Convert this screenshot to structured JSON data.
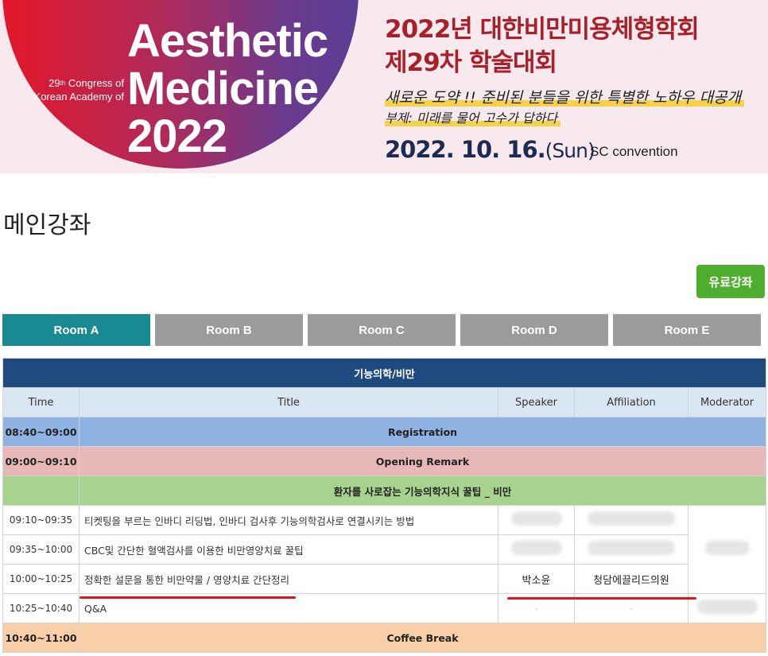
{
  "banner": {
    "congress_sup": "th",
    "congress_prefix": "29",
    "congress_line1": "Congress of",
    "congress_line2": "Korean Academy of",
    "title_line1": "Aesthetic",
    "title_line2": "Medicine",
    "title_line3": "2022",
    "kr_title_line1": "2022년 대한비만미용체형학회",
    "kr_title_line2": "제29차 학술대회",
    "subtitle": "새로운 도약 !! 준비된 분들을 위한 특별한 노하우 대공개",
    "subtitle2": "부제: 미래를 물어 고수가 답하다",
    "date": "2022. 10. 16.",
    "day": "(Sun)",
    "venue": "SC convention"
  },
  "page_title": "메인강좌",
  "paid_button": "유료강좌",
  "rooms": [
    "Room A",
    "Room B",
    "Room C",
    "Room D",
    "Room E"
  ],
  "active_room": "Room A",
  "table": {
    "category": "기능의학/비만",
    "columns": [
      "Time",
      "Title",
      "Speaker",
      "Affiliation",
      "Moderator"
    ],
    "registration": {
      "time": "08:40~09:00",
      "label": "Registration"
    },
    "opening": {
      "time": "09:00~09:10",
      "label": "Opening Remark"
    },
    "session": {
      "label": "환자를 사로잡는 기능의학지식 꿀팁 _ 비만"
    },
    "lectures": [
      {
        "time": "09:10~09:35",
        "title": "티켓팅을 부르는 인바디 리딩법, 인바디 검사후 기능의학검사로 연결시키는 방법"
      },
      {
        "time": "09:35~10:00",
        "title": "CBC및 간단한 혈액검사를 이용한 비만영양치료 꿀팁"
      },
      {
        "time": "10:00~10:25",
        "title": "정확한 설문을 통한 비만약물 / 영양치료 간단정리",
        "speaker": "박소윤",
        "affiliation": "청담에끌리드의원"
      },
      {
        "time": "10:25~10:40",
        "title": "Q&A",
        "speaker": "-",
        "affiliation": "-"
      }
    ],
    "coffee": {
      "time": "10:40~11:00",
      "label": "Coffee Break"
    }
  },
  "colors": {
    "accent_red": "#a8202a",
    "active_tab": "#1a8a92",
    "inactive_tab": "#9b9b9b",
    "table_header": "#1e4a7f",
    "paid_button": "#4fae2f"
  }
}
